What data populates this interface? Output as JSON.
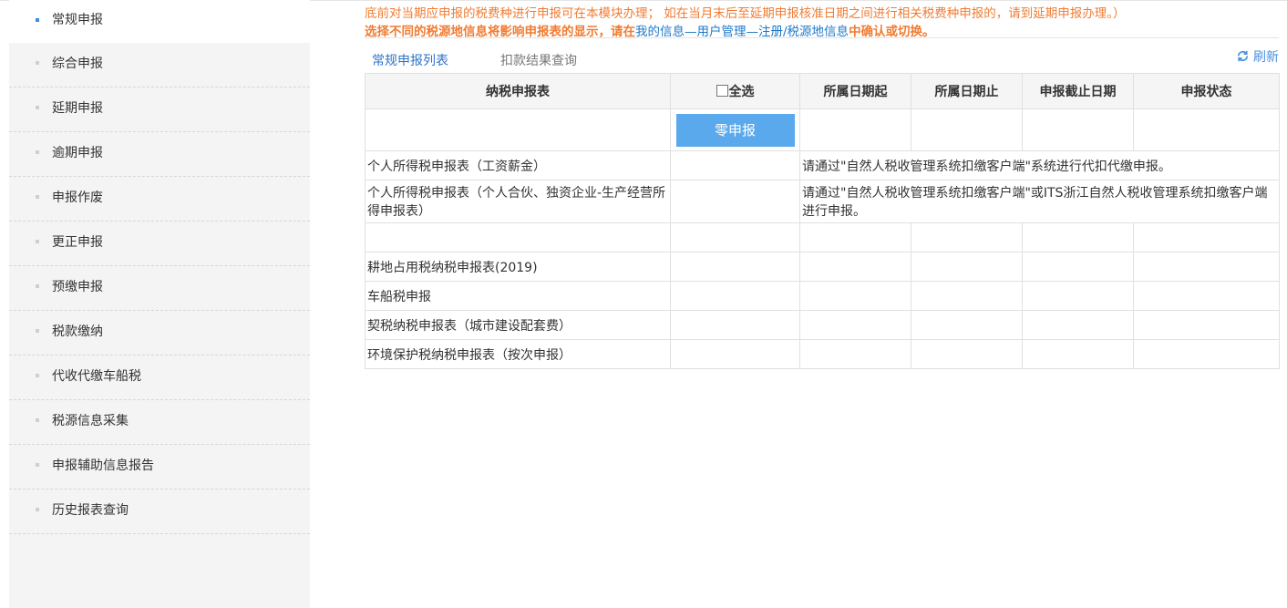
{
  "sidebar": {
    "items": [
      {
        "label": "常规申报",
        "active": true
      },
      {
        "label": "综合申报"
      },
      {
        "label": "延期申报"
      },
      {
        "label": "逾期申报"
      },
      {
        "label": "申报作废"
      },
      {
        "label": "更正申报"
      },
      {
        "label": "预缴申报"
      },
      {
        "label": "税款缴纳"
      },
      {
        "label": "代收代缴车船税"
      },
      {
        "label": "税源信息采集"
      },
      {
        "label": "申报辅助信息报告"
      },
      {
        "label": "历史报表查询"
      }
    ]
  },
  "notice": {
    "line1": "底前对当期应申报的税费种进行申报可在本模块办理； 如在当月末后至延期申报核准日期之间进行相关税费种申报的，请到延期申报办理。）",
    "line2_prefix": "选择不同的税源地信息将影响申报表的显示，请在",
    "line2_link": "我的信息—用户管理—注册/税源地信息",
    "line2_suffix": "中确认或切换。"
  },
  "tabs": [
    {
      "label": "常规申报列表",
      "active": true
    },
    {
      "label": "扣款结果查询"
    }
  ],
  "refresh_label": "刷新",
  "colors": {
    "accent": "#2f74c9",
    "notice": "#f07c33",
    "button": "#5aa9ec"
  },
  "table": {
    "headers": {
      "form": "纳税申报表",
      "select_all": "全选",
      "period_start": "所属日期起",
      "period_end": "所属日期止",
      "deadline": "申报截止日期",
      "status": "申报状态"
    },
    "zero_button": "零申报",
    "rows": [
      {
        "name": "个人所得税申报表（工资薪金）",
        "note": "请通过\"自然人税收管理系统扣缴客户端\"系统进行代扣代缴申报。"
      },
      {
        "name": "个人所得税申报表（个人合伙、独资企业-生产经营所得申报表）",
        "note": "请通过\"自然人税收管理系统扣缴客户端\"或ITS浙江自然人税收管理系统扣缴客户端进行申报。"
      },
      {
        "name": "耕地占用税纳税申报表(2019)"
      },
      {
        "name": "车船税申报"
      },
      {
        "name": "契税纳税申报表（城市建设配套费）"
      },
      {
        "name": "环境保护税纳税申报表（按次申报）"
      }
    ]
  }
}
